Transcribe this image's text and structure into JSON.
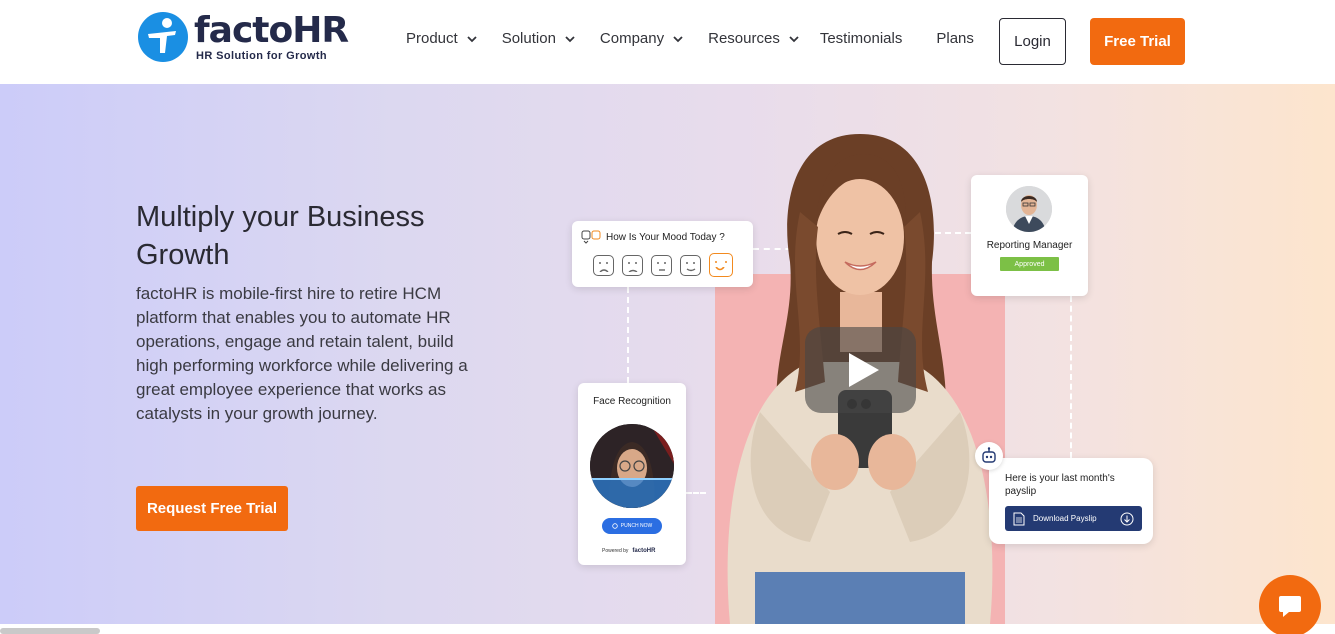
{
  "brand": {
    "name": "factoHR",
    "tagline": "HR Solution for Growth",
    "accent_color": "#f26a10",
    "logo_blue": "#1a8fe3",
    "navy": "#242a4a"
  },
  "nav": {
    "items": [
      {
        "label": "Product",
        "has_dropdown": true
      },
      {
        "label": "Solution",
        "has_dropdown": true
      },
      {
        "label": "Company",
        "has_dropdown": true
      },
      {
        "label": "Resources",
        "has_dropdown": true
      },
      {
        "label": "Testimonials",
        "has_dropdown": false
      },
      {
        "label": "Plans",
        "has_dropdown": false
      }
    ],
    "login_label": "Login",
    "trial_label": "Free Trial"
  },
  "hero": {
    "title": "Multiply your Business Growth",
    "description": "factoHR is mobile-first hire to retire HCM platform that enables you to automate HR operations, engage and retain talent, build high performing workforce while delivering a great employee experience that works as catalysts in your growth journey.",
    "cta_label": "Request Free Trial"
  },
  "cards": {
    "mood": {
      "title": "How Is Your Mood Today ?",
      "selected_index": 4
    },
    "manager": {
      "title": "Reporting Manager",
      "badge": "Approved"
    },
    "face": {
      "title": "Face Recognition",
      "punch_label": "PUNCH NOW",
      "powered_by": "Powered by",
      "powered_brand": "factoHR"
    },
    "payslip": {
      "message": "Here is your last month's payslip",
      "button_label": "Download Payslip"
    }
  },
  "icons": {
    "play": "play-icon",
    "chat": "chat-icon",
    "bot": "bot-icon"
  }
}
